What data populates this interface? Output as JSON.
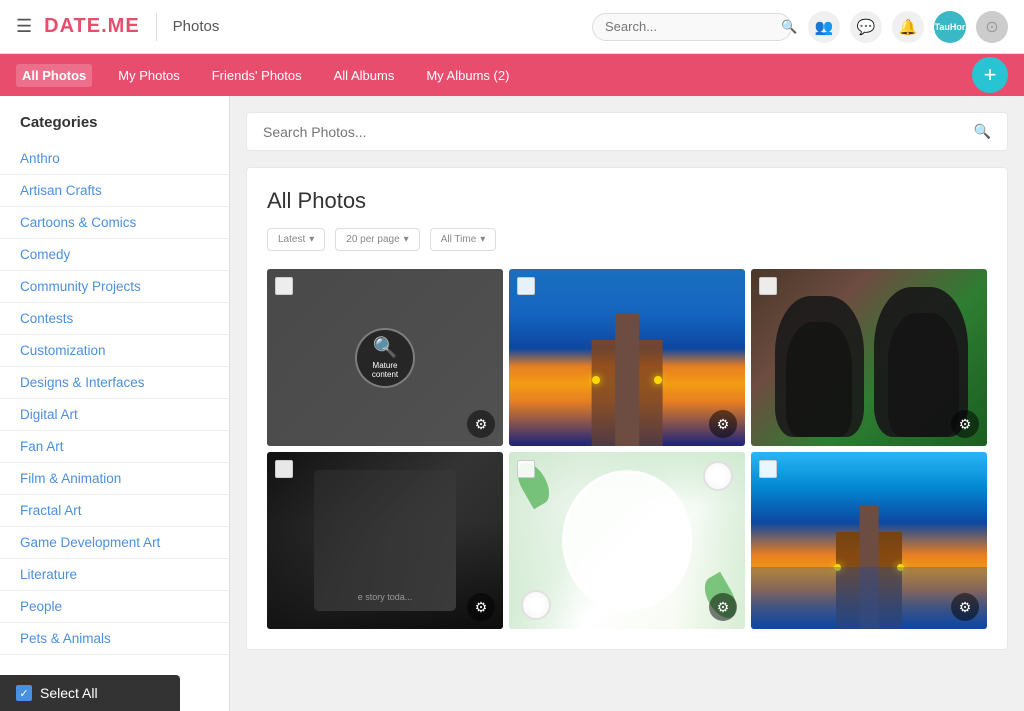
{
  "header": {
    "logo": "DATE.ME",
    "photos_label": "Photos",
    "search_placeholder": "Search...",
    "avatar_text": "TauHor",
    "icons": [
      "people-icon",
      "chat-icon",
      "bell-icon"
    ]
  },
  "nav": {
    "items": [
      {
        "label": "All Photos",
        "active": true
      },
      {
        "label": "My Photos",
        "active": false
      },
      {
        "label": "Friends' Photos",
        "active": false
      },
      {
        "label": "All Albums",
        "active": false
      },
      {
        "label": "My Albums (2)",
        "active": false
      }
    ],
    "add_button_label": "+"
  },
  "sidebar": {
    "title": "Categories",
    "items": [
      {
        "label": "Anthro"
      },
      {
        "label": "Artisan Crafts"
      },
      {
        "label": "Cartoons & Comics"
      },
      {
        "label": "Comedy"
      },
      {
        "label": "Community Projects"
      },
      {
        "label": "Contests"
      },
      {
        "label": "Customization"
      },
      {
        "label": "Designs & Interfaces"
      },
      {
        "label": "Digital Art"
      },
      {
        "label": "Fan Art"
      },
      {
        "label": "Film & Animation"
      },
      {
        "label": "Fractal Art"
      },
      {
        "label": "Game Development Art"
      },
      {
        "label": "Literature"
      },
      {
        "label": "People"
      },
      {
        "label": "Pets & Animals"
      }
    ]
  },
  "photo_search": {
    "placeholder": "Search Photos..."
  },
  "all_photos": {
    "title": "All Photos",
    "filters": [
      {
        "label": "Latest",
        "id": "filter-latest"
      },
      {
        "label": "20 per page",
        "id": "filter-perpage"
      },
      {
        "label": "All Time",
        "id": "filter-time"
      }
    ],
    "photos": [
      {
        "type": "mature",
        "style": "dark"
      },
      {
        "type": "ocean",
        "style": "ocean"
      },
      {
        "type": "gorilla",
        "style": "gorilla"
      },
      {
        "type": "dark2",
        "style": "dark2"
      },
      {
        "type": "floral",
        "style": "floral"
      },
      {
        "type": "ocean2",
        "style": "ocean2"
      }
    ]
  },
  "select_all": {
    "label": "Select All"
  }
}
